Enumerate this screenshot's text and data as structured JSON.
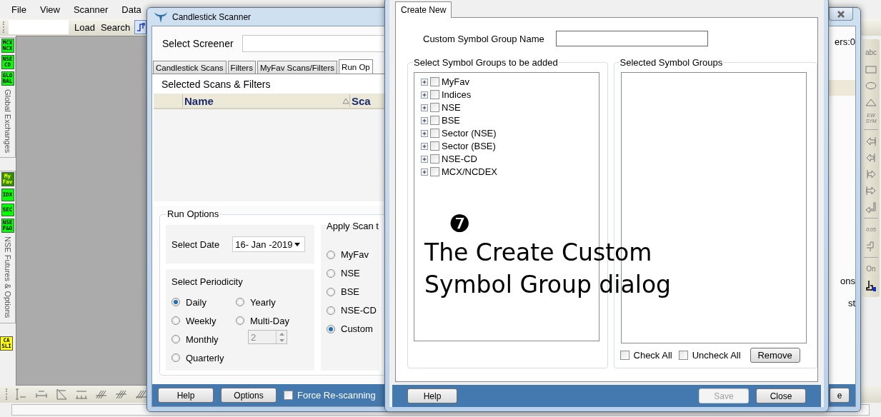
{
  "menu": [
    "File",
    "View",
    "Scanner",
    "Data"
  ],
  "toolbar": {
    "buttons": [
      "Load",
      "Search"
    ]
  },
  "left_sidebar": {
    "groups": [
      {
        "label": "Global Exchanges",
        "badges": [
          {
            "lines": [
              "MCX",
              "NCX"
            ],
            "color": "#00ff00"
          },
          {
            "lines": [
              "NSE",
              "CD"
            ],
            "color": "#00ff00"
          },
          {
            "lines": [
              "GLO",
              "BAL"
            ],
            "color": "#00ff00"
          }
        ]
      },
      {
        "label": "NSE Futures & Options",
        "badges": [
          {
            "lines": [
              "My",
              "Fav"
            ],
            "color": "#2f8f00"
          },
          {
            "lines": [
              "IDX"
            ],
            "color": "#00ff00"
          },
          {
            "lines": [
              "SEC"
            ],
            "color": "#00ff00"
          },
          {
            "lines": [
              "NSE",
              "F&O"
            ],
            "color": "#00ff00"
          }
        ]
      }
    ],
    "bottom_badge": {
      "lines": [
        "CA",
        "SLI"
      ],
      "color": "#ffff00"
    }
  },
  "right_toolbar": {
    "items": [
      {
        "kind": "text",
        "label": "abc"
      },
      {
        "kind": "icon"
      },
      {
        "kind": "icon"
      },
      {
        "kind": "icon"
      },
      {
        "kind": "text",
        "label": "EW SYM"
      },
      {
        "kind": "separator"
      },
      {
        "kind": "icon"
      },
      {
        "kind": "icon"
      },
      {
        "kind": "icon"
      },
      {
        "kind": "icon"
      },
      {
        "kind": "icon"
      },
      {
        "kind": "separator"
      },
      {
        "kind": "text",
        "label": "0:05"
      },
      {
        "kind": "icon"
      },
      {
        "kind": "separator"
      },
      {
        "kind": "text",
        "label": "On"
      },
      {
        "kind": "icon"
      }
    ]
  },
  "scanner_window": {
    "title": "Candlestick Scanner",
    "screener_label": "Select Screener",
    "tabs": [
      {
        "label": "Candlestick Scans",
        "selected": false
      },
      {
        "label": "Filters",
        "selected": false
      },
      {
        "label": "MyFav Scans/Filters",
        "selected": false
      },
      {
        "label": "Run Op",
        "selected": true
      }
    ],
    "selected_label": "Selected Scans & Filters",
    "columns": [
      {
        "label": "Name",
        "sorted": true
      },
      {
        "label": "Sca",
        "sorted": false
      }
    ],
    "run_options": {
      "title": "Run Options",
      "date_label": "Select Date",
      "date_value": "16- Jan -2019",
      "periodicity_label": "Select Periodicity",
      "periodicity": [
        {
          "label": "Daily",
          "selected": true
        },
        {
          "label": "Weekly",
          "selected": false
        },
        {
          "label": "Monthly",
          "selected": false
        },
        {
          "label": "Quarterly",
          "selected": false
        },
        {
          "label": "Yearly",
          "selected": false
        },
        {
          "label": "Multi-Day",
          "selected": false
        }
      ],
      "multi_day_value": "2",
      "apply_label": "Apply Scan t",
      "apply": [
        {
          "label": "MyFav",
          "selected": false
        },
        {
          "label": "NSE",
          "selected": false
        },
        {
          "label": "BSE",
          "selected": false
        },
        {
          "label": "NSE-CD",
          "selected": false
        },
        {
          "label": "Custom",
          "selected": true
        }
      ]
    },
    "footer": {
      "buttons": [
        "Help",
        "Options"
      ],
      "force": {
        "label": "Force Re-scanning",
        "checked": false
      }
    },
    "right_edge": {
      "status": "ers:0",
      "texts": [
        "ons",
        "st"
      ],
      "button": "e"
    }
  },
  "dialog": {
    "tab": {
      "label": "Create New",
      "selected": true
    },
    "name_label": "Custom Symbol Group Name",
    "groups_title": "Select Symbol Groups to be added",
    "tree": [
      {
        "label": "MyFav",
        "checked": false,
        "expanded": false
      },
      {
        "label": "Indices",
        "checked": false,
        "expanded": false
      },
      {
        "label": "NSE",
        "checked": false,
        "expanded": false
      },
      {
        "label": "BSE",
        "checked": false,
        "expanded": false
      },
      {
        "label": "Sector (NSE)",
        "checked": false,
        "expanded": false
      },
      {
        "label": "Sector (BSE)",
        "checked": false,
        "expanded": false
      },
      {
        "label": "NSE-CD",
        "checked": false,
        "expanded": false
      },
      {
        "label": "MCX/NCDEX",
        "checked": false,
        "expanded": false
      }
    ],
    "selected_title": "Selected Symbol Groups",
    "checks": [
      {
        "label": "Check All",
        "checked": false
      },
      {
        "label": "Uncheck All",
        "checked": false
      }
    ],
    "remove": "Remove",
    "footer": [
      {
        "label": "Help",
        "disabled": false
      },
      {
        "label": "Save",
        "disabled": true
      },
      {
        "label": "Close",
        "disabled": false
      }
    ]
  },
  "annotation": {
    "number": "❼",
    "lines": [
      "The Create Custom",
      "Symbol Group dialog"
    ]
  }
}
